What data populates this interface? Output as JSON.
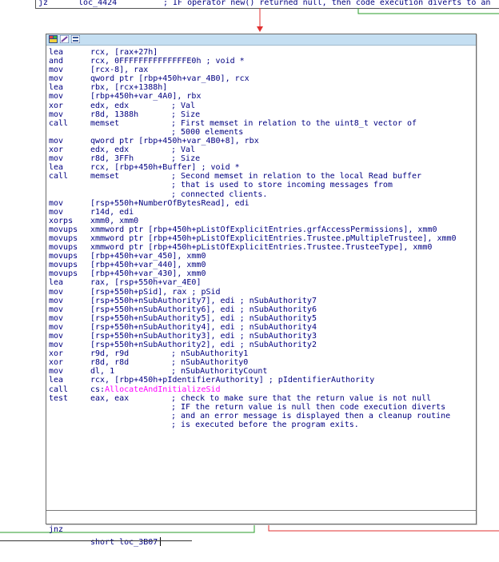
{
  "prev_block": {
    "mnemonic": "jz",
    "operand": "loc_4424",
    "comment": "; IF operator new() returned null, then code execution diverts to an"
  },
  "colors": {
    "edge_false": "#e03030",
    "edge_true": "#2a9d2a",
    "header_bg": "#c5dff2",
    "instr_text": "#000080",
    "imported_function": "#ff00ff"
  },
  "header_icons": [
    "graph-color-icon",
    "rename-node-icon",
    "group-nodes-icon"
  ],
  "instructions": [
    {
      "m": "lea",
      "o": "rcx, [rax+27h]",
      "c": ""
    },
    {
      "m": "and",
      "o": "rcx, 0FFFFFFFFFFFFFFE0h ; void *",
      "c": ""
    },
    {
      "m": "mov",
      "o": "[rcx-8], rax",
      "c": ""
    },
    {
      "m": "mov",
      "o": "qword ptr [rbp+450h+var_4B0], rcx",
      "c": ""
    },
    {
      "m": "lea",
      "o": "rbx, [rcx+1388h]",
      "c": ""
    },
    {
      "m": "mov",
      "o": "[rbp+450h+var_4A0], rbx",
      "c": ""
    },
    {
      "m": "xor",
      "o": "edx, edx",
      "c": "; Val"
    },
    {
      "m": "mov",
      "o": "r8d, 1388h",
      "c": "; Size"
    },
    {
      "m": "call",
      "o": "memset",
      "c": "; First memset in relation to the uint8_t vector of"
    },
    {
      "m": "",
      "o": "",
      "c": "; 5000 elements"
    },
    {
      "m": "mov",
      "o": "qword ptr [rbp+450h+var_4B0+8], rbx",
      "c": ""
    },
    {
      "m": "xor",
      "o": "edx, edx",
      "c": "; Val"
    },
    {
      "m": "mov",
      "o": "r8d, 3FFh",
      "c": "; Size"
    },
    {
      "m": "lea",
      "o": "rcx, [rbp+450h+Buffer] ; void *",
      "c": ""
    },
    {
      "m": "call",
      "o": "memset",
      "c": "; Second memset in relation to the local Read buffer"
    },
    {
      "m": "",
      "o": "",
      "c": "; that is used to store incoming messages from"
    },
    {
      "m": "",
      "o": "",
      "c": "; connected clients."
    },
    {
      "m": "mov",
      "o": "[rsp+550h+NumberOfBytesRead], edi",
      "c": ""
    },
    {
      "m": "mov",
      "o": "r14d, edi",
      "c": ""
    },
    {
      "m": "xorps",
      "o": "xmm0, xmm0",
      "c": ""
    },
    {
      "m": "movups",
      "o": "xmmword ptr [rbp+450h+pListOfExplicitEntries.grfAccessPermissions], xmm0",
      "c": ""
    },
    {
      "m": "movups",
      "o": "xmmword ptr [rbp+450h+pListOfExplicitEntries.Trustee.pMultipleTrustee], xmm0",
      "c": ""
    },
    {
      "m": "movups",
      "o": "xmmword ptr [rbp+450h+pListOfExplicitEntries.Trustee.TrusteeType], xmm0",
      "c": ""
    },
    {
      "m": "movups",
      "o": "[rbp+450h+var_450], xmm0",
      "c": ""
    },
    {
      "m": "movups",
      "o": "[rbp+450h+var_440], xmm0",
      "c": ""
    },
    {
      "m": "movups",
      "o": "[rbp+450h+var_430], xmm0",
      "c": ""
    },
    {
      "m": "lea",
      "o": "rax, [rsp+550h+var_4E0]",
      "c": ""
    },
    {
      "m": "mov",
      "o": "[rsp+550h+pSid], rax ; pSid",
      "c": ""
    },
    {
      "m": "mov",
      "o": "[rsp+550h+nSubAuthority7], edi ; nSubAuthority7",
      "c": ""
    },
    {
      "m": "mov",
      "o": "[rsp+550h+nSubAuthority6], edi ; nSubAuthority6",
      "c": ""
    },
    {
      "m": "mov",
      "o": "[rsp+550h+nSubAuthority5], edi ; nSubAuthority5",
      "c": ""
    },
    {
      "m": "mov",
      "o": "[rsp+550h+nSubAuthority4], edi ; nSubAuthority4",
      "c": ""
    },
    {
      "m": "mov",
      "o": "[rsp+550h+nSubAuthority3], edi ; nSubAuthority3",
      "c": ""
    },
    {
      "m": "mov",
      "o": "[rsp+550h+nSubAuthority2], edi ; nSubAuthority2",
      "c": ""
    },
    {
      "m": "xor",
      "o": "r9d, r9d",
      "c": "; nSubAuthority1"
    },
    {
      "m": "xor",
      "o": "r8d, r8d",
      "c": "; nSubAuthority0"
    },
    {
      "m": "mov",
      "o": "dl, 1",
      "c": "; nSubAuthorityCount"
    },
    {
      "m": "lea",
      "o": "rcx, [rbp+450h+pIdentifierAuthority] ; pIdentifierAuthority",
      "c": ""
    },
    {
      "m": "call",
      "o": "cs:AllocateAndInitializeSid",
      "c": "",
      "imported": true
    },
    {
      "m": "test",
      "o": "eax, eax",
      "c": "; check to make sure that the return value is not null"
    },
    {
      "m": "",
      "o": "",
      "c": "; IF the return value is null then code execution diverts"
    },
    {
      "m": "",
      "o": "",
      "c": "; and an error message is displayed then a cleanup routine"
    },
    {
      "m": "",
      "o": "",
      "c": "; is executed before the program exits."
    }
  ],
  "branch": {
    "mnemonic": "jnz",
    "operand": "short loc_3B07"
  }
}
